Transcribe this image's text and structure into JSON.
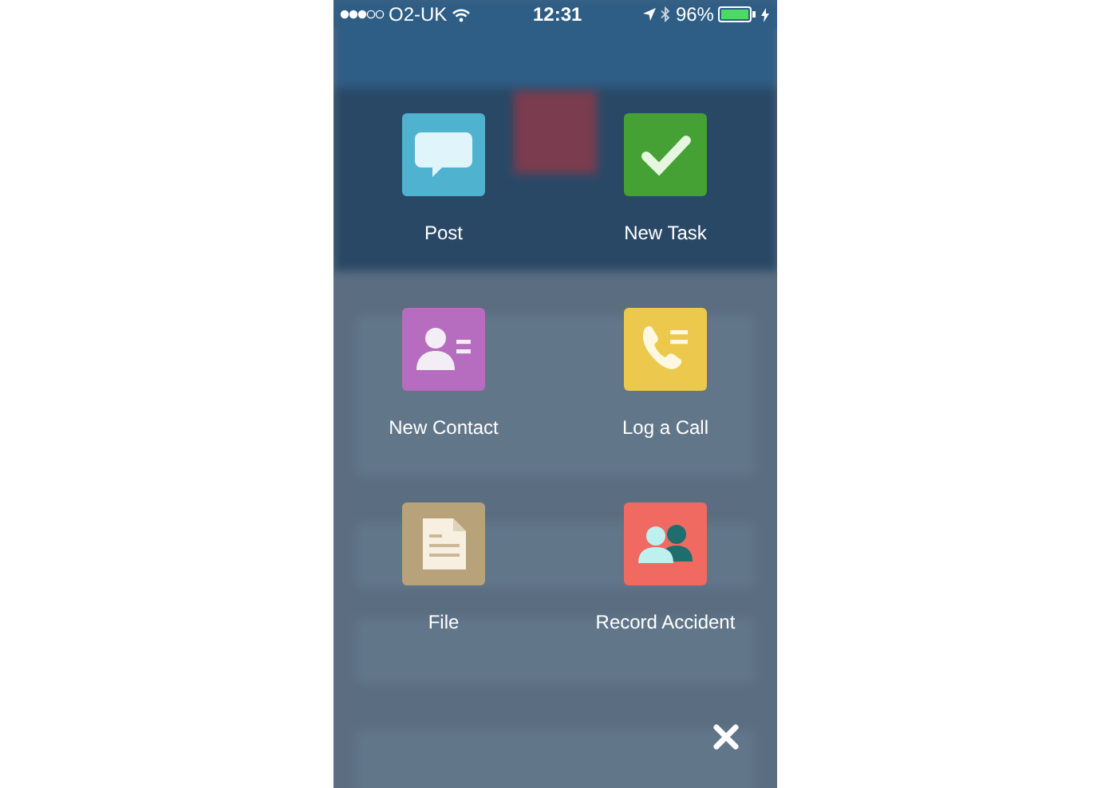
{
  "status_bar": {
    "carrier": "O2-UK",
    "time": "12:31",
    "battery": "96%"
  },
  "actions": [
    {
      "label": "Post",
      "kind": "chat"
    },
    {
      "label": "New Task",
      "kind": "check"
    },
    {
      "label": "New Contact",
      "kind": "contact"
    },
    {
      "label": "Log a Call",
      "kind": "call"
    },
    {
      "label": "File",
      "kind": "file"
    },
    {
      "label": "Record Accident",
      "kind": "accident"
    }
  ]
}
